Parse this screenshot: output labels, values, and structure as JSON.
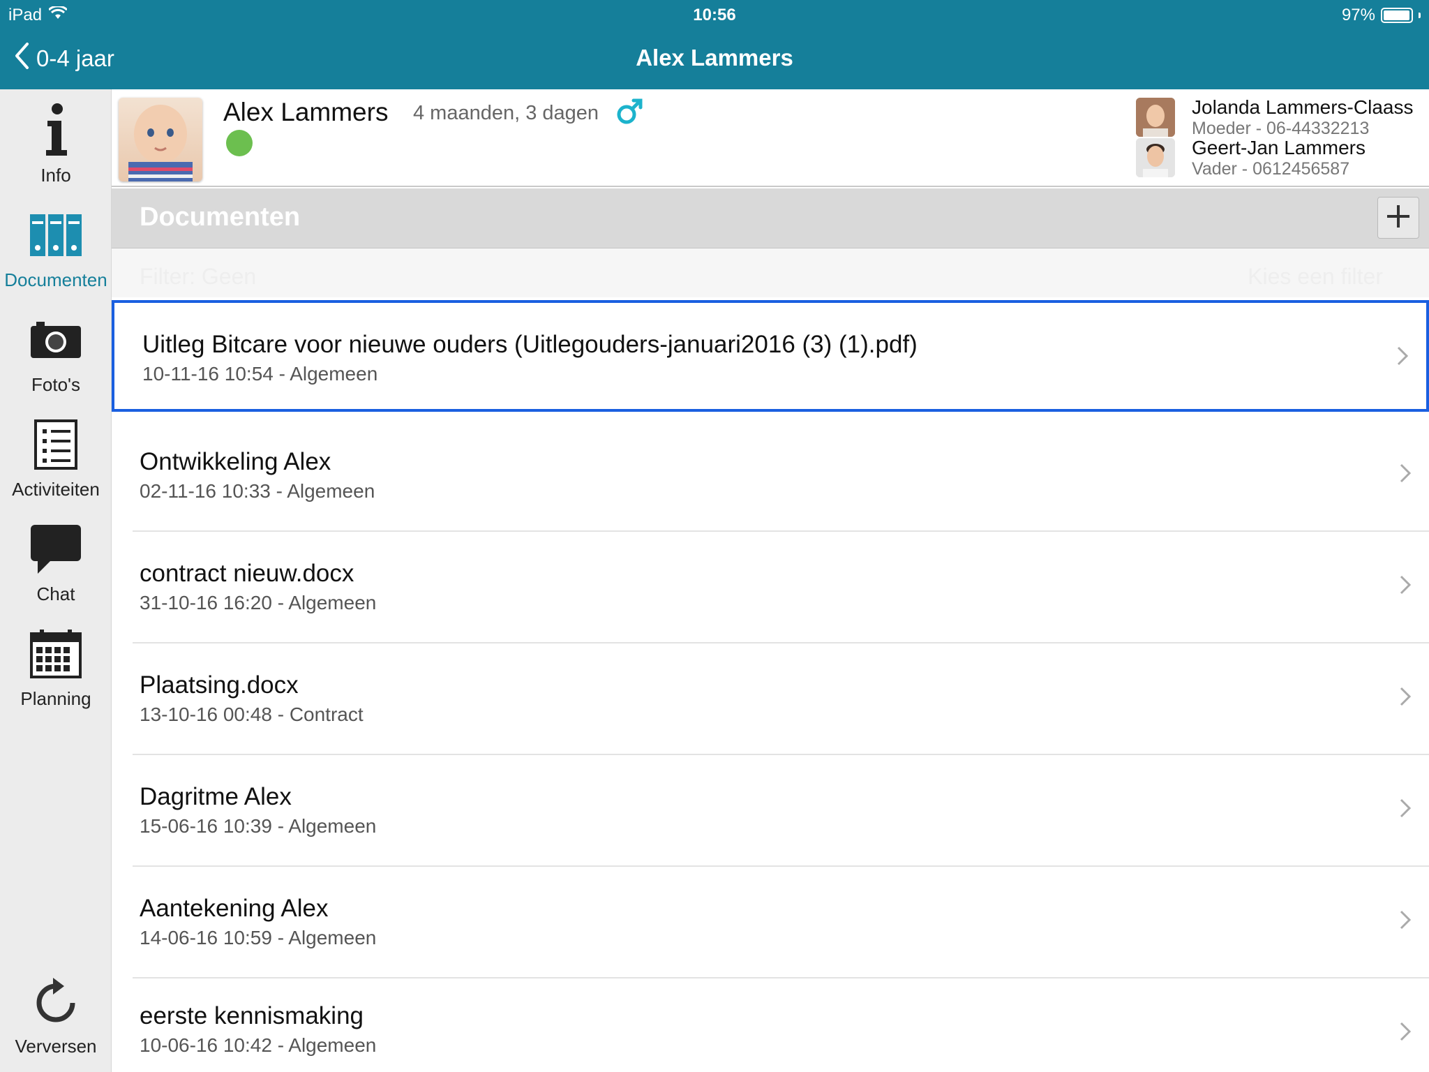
{
  "status_bar": {
    "carrier": "iPad",
    "time": "10:56",
    "battery": "97%",
    "battery_level": 0.97
  },
  "nav": {
    "back_label": "0-4 jaar",
    "title": "Alex Lammers"
  },
  "sidebar": {
    "items": [
      {
        "label": "Info",
        "icon": "info-icon",
        "active": false
      },
      {
        "label": "Documenten",
        "icon": "binders-icon",
        "active": true
      },
      {
        "label": "Foto's",
        "icon": "camera-icon",
        "active": false
      },
      {
        "label": "Activiteiten",
        "icon": "checklist-icon",
        "active": false
      },
      {
        "label": "Chat",
        "icon": "chat-bubble-icon",
        "active": false
      },
      {
        "label": "Planning",
        "icon": "calendar-icon",
        "active": false
      }
    ],
    "refresh_label": "Verversen"
  },
  "child": {
    "name": "Alex Lammers",
    "age": "4 maanden, 3 dagen",
    "gender_icon": "male-symbol-icon",
    "status_color": "#6cbf4f"
  },
  "parents": [
    {
      "name": "Jolanda Lammers-Claass",
      "info": "Moeder - 06-44332213"
    },
    {
      "name": "Geert-Jan Lammers",
      "info": "Vader - 0612456587"
    }
  ],
  "section": {
    "title": "Documenten",
    "add_icon": "plus-icon"
  },
  "filter": {
    "label": "Filter:  Geen",
    "action": "Kies een filter"
  },
  "documents": [
    {
      "title": "Uitleg Bitcare voor nieuwe ouders (Uitlegouders-januari2016 (3) (1).pdf)",
      "meta": "10-11-16 10:54 - Algemeen",
      "selected": true
    },
    {
      "title": "Ontwikkeling Alex",
      "meta": "02-11-16 10:33 - Algemeen",
      "selected": false
    },
    {
      "title": "contract nieuw.docx",
      "meta": "31-10-16 16:20 - Algemeen",
      "selected": false
    },
    {
      "title": "Plaatsing.docx",
      "meta": "13-10-16 00:48 - Contract",
      "selected": false
    },
    {
      "title": "Dagritme Alex",
      "meta": "15-06-16 10:39 - Algemeen",
      "selected": false
    },
    {
      "title": "Aantekening Alex",
      "meta": "14-06-16 10:59 - Algemeen",
      "selected": false
    },
    {
      "title": "eerste kennismaking",
      "meta": "10-06-16 10:42 - Algemeen",
      "selected": false
    }
  ],
  "colors": {
    "nav_bar": "#157f9a",
    "accent": "#157f9a",
    "selection": "#1a5fe0",
    "sidebar_bg": "#ececec"
  }
}
